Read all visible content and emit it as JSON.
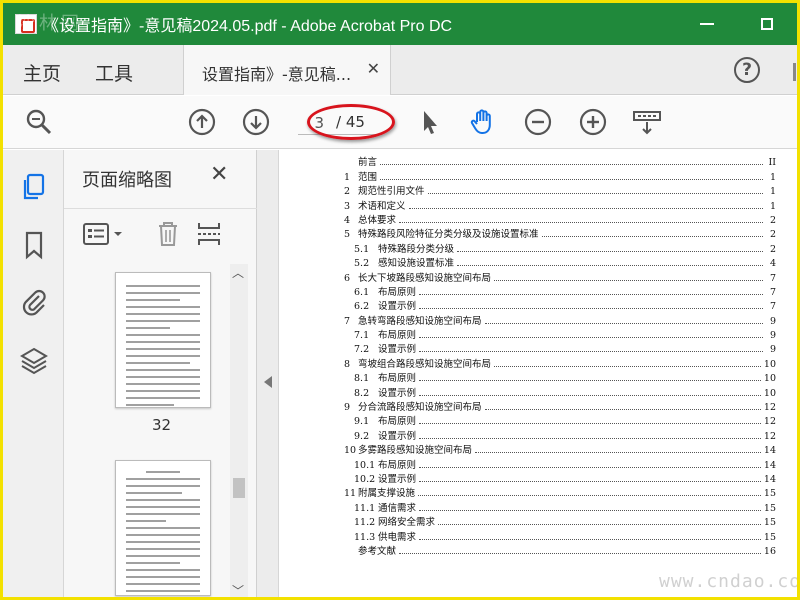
{
  "window": {
    "title": "《设置指南》-意见稿2024.05.pdf - Adobe Acrobat Pro DC",
    "watermark": "沙林网"
  },
  "menu": {
    "home": "主页",
    "tools": "工具",
    "tab_label": "设置指南》-意见稿...",
    "tab_close": "✕",
    "help": "?"
  },
  "toolbar": {
    "current_page": "3",
    "page_total": "/ 45"
  },
  "left_panel": {
    "title": "页面缩略图",
    "close": "✕",
    "thumb_page_label": "32"
  },
  "toc": [
    {
      "num": "",
      "title": "前言",
      "page": "II",
      "level": 1
    },
    {
      "num": "1",
      "title": "范围",
      "page": "1",
      "level": 1
    },
    {
      "num": "2",
      "title": "规范性引用文件",
      "page": "1",
      "level": 1
    },
    {
      "num": "3",
      "title": "术语和定义",
      "page": "1",
      "level": 1
    },
    {
      "num": "4",
      "title": "总体要求",
      "page": "2",
      "level": 1
    },
    {
      "num": "5",
      "title": "特殊路段风险特征分类分级及设施设置标准",
      "page": "2",
      "level": 1
    },
    {
      "num": "5.1",
      "title": "特殊路段分类分级",
      "page": "2",
      "level": 2
    },
    {
      "num": "5.2",
      "title": "感知设施设置标准",
      "page": "4",
      "level": 2
    },
    {
      "num": "6",
      "title": "长大下坡路段感知设施空间布局",
      "page": "7",
      "level": 1
    },
    {
      "num": "6.1",
      "title": "布局原则",
      "page": "7",
      "level": 2
    },
    {
      "num": "6.2",
      "title": "设置示例",
      "page": "7",
      "level": 2
    },
    {
      "num": "7",
      "title": "急转弯路段感知设施空间布局",
      "page": "9",
      "level": 1
    },
    {
      "num": "7.1",
      "title": "布局原则",
      "page": "9",
      "level": 2
    },
    {
      "num": "7.2",
      "title": "设置示例",
      "page": "9",
      "level": 2
    },
    {
      "num": "8",
      "title": "弯坡组合路段感知设施空间布局",
      "page": "10",
      "level": 1
    },
    {
      "num": "8.1",
      "title": "布局原则",
      "page": "10",
      "level": 2
    },
    {
      "num": "8.2",
      "title": "设置示例",
      "page": "10",
      "level": 2
    },
    {
      "num": "9",
      "title": "分合流路段感知设施空间布局",
      "page": "12",
      "level": 1
    },
    {
      "num": "9.1",
      "title": "布局原则",
      "page": "12",
      "level": 2
    },
    {
      "num": "9.2",
      "title": "设置示例",
      "page": "12",
      "level": 2
    },
    {
      "num": "10",
      "title": "多雾路段感知设施空间布局",
      "page": "14",
      "level": 1
    },
    {
      "num": "10.1",
      "title": "布局原则",
      "page": "14",
      "level": 2
    },
    {
      "num": "10.2",
      "title": "设置示例",
      "page": "14",
      "level": 2
    },
    {
      "num": "11",
      "title": "附属支撑设施",
      "page": "15",
      "level": 1
    },
    {
      "num": "11.1",
      "title": "通信需求",
      "page": "15",
      "level": 2
    },
    {
      "num": "11.2",
      "title": "网络安全需求",
      "page": "15",
      "level": 2
    },
    {
      "num": "11.3",
      "title": "供电需求",
      "page": "15",
      "level": 2
    },
    {
      "num": "",
      "title": "参考文献",
      "page": "16",
      "level": 1
    }
  ],
  "watermark_br": "www.cndao.com",
  "colors": {
    "titlebar": "#20893b",
    "accent_blue": "#1473e6",
    "annotation_red": "#d8141d",
    "frame_yellow": "#f3e100"
  }
}
